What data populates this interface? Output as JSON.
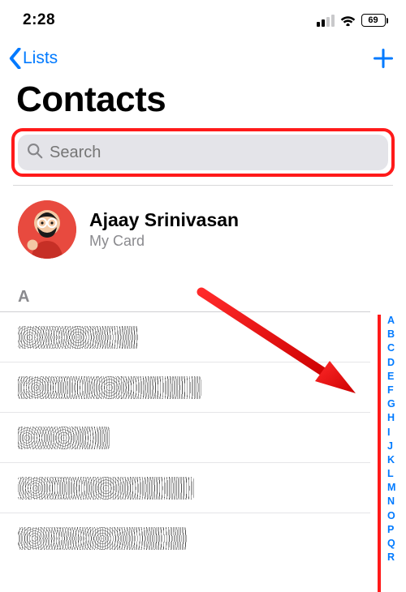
{
  "status": {
    "time": "2:28",
    "battery": "69"
  },
  "nav": {
    "back": "Lists"
  },
  "title": "Contacts",
  "search": {
    "placeholder": "Search"
  },
  "mycard": {
    "name": "Ajaay Srinivasan",
    "sub": "My Card"
  },
  "section": {
    "header": "A"
  },
  "index": [
    "A",
    "B",
    "C",
    "D",
    "E",
    "F",
    "G",
    "H",
    "I",
    "J",
    "K",
    "L",
    "M",
    "N",
    "O",
    "P",
    "Q",
    "R"
  ]
}
